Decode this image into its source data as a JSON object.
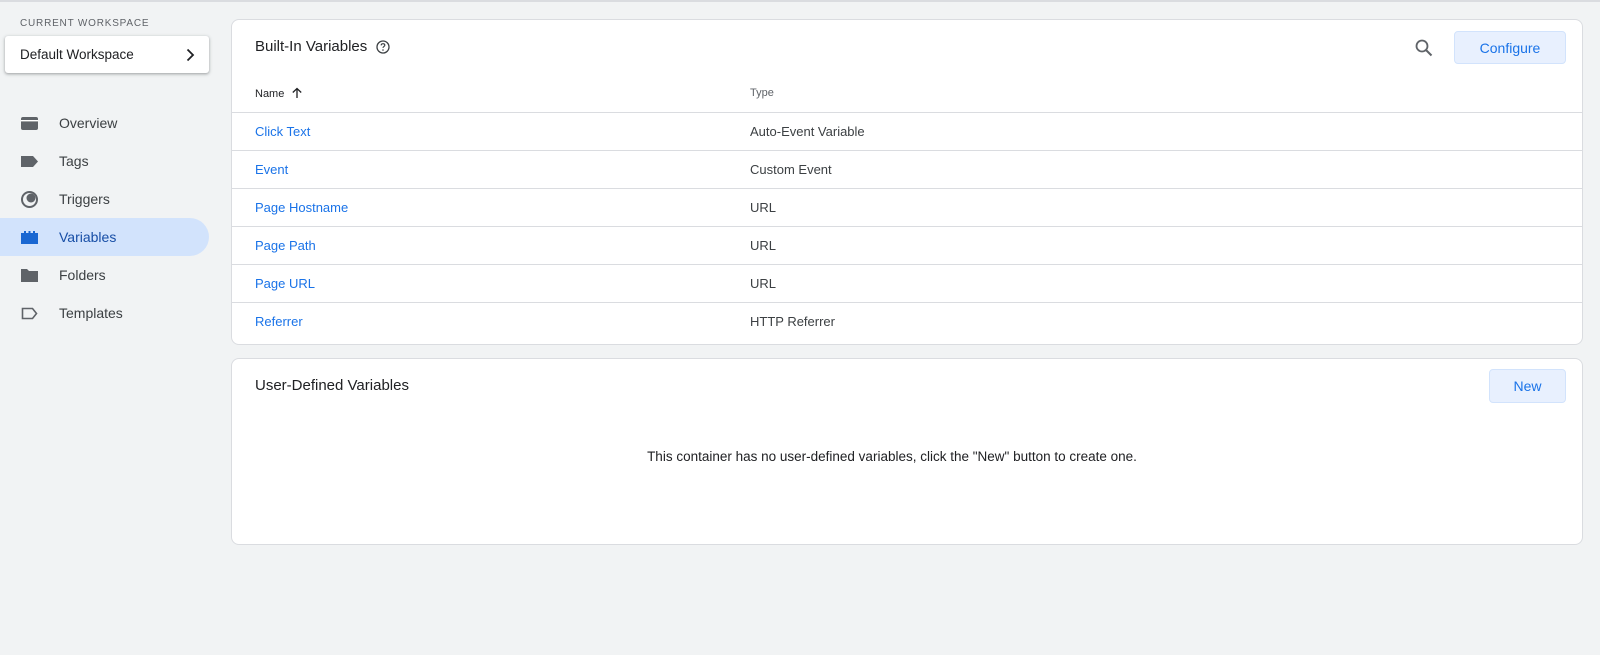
{
  "sidebar": {
    "workspace_label": "CURRENT WORKSPACE",
    "workspace_name": "Default Workspace",
    "items": [
      {
        "label": "Overview",
        "icon": "overview-icon"
      },
      {
        "label": "Tags",
        "icon": "tag-icon"
      },
      {
        "label": "Triggers",
        "icon": "trigger-icon"
      },
      {
        "label": "Variables",
        "icon": "variables-icon",
        "active": true
      },
      {
        "label": "Folders",
        "icon": "folder-icon"
      },
      {
        "label": "Templates",
        "icon": "template-icon"
      }
    ]
  },
  "builtin": {
    "title": "Built-In Variables",
    "configure_label": "Configure",
    "columns": {
      "name": "Name",
      "type": "Type"
    },
    "rows": [
      {
        "name": "Click Text",
        "type": "Auto-Event Variable"
      },
      {
        "name": "Event",
        "type": "Custom Event"
      },
      {
        "name": "Page Hostname",
        "type": "URL"
      },
      {
        "name": "Page Path",
        "type": "URL"
      },
      {
        "name": "Page URL",
        "type": "URL"
      },
      {
        "name": "Referrer",
        "type": "HTTP Referrer"
      }
    ]
  },
  "userdefined": {
    "title": "User-Defined Variables",
    "new_label": "New",
    "empty_message": "This container has no user-defined variables, click the \"New\" button to create one."
  },
  "colors": {
    "accent": "#1a73e8",
    "active_bg": "#d2e3fc",
    "page_bg": "#f1f3f4"
  }
}
